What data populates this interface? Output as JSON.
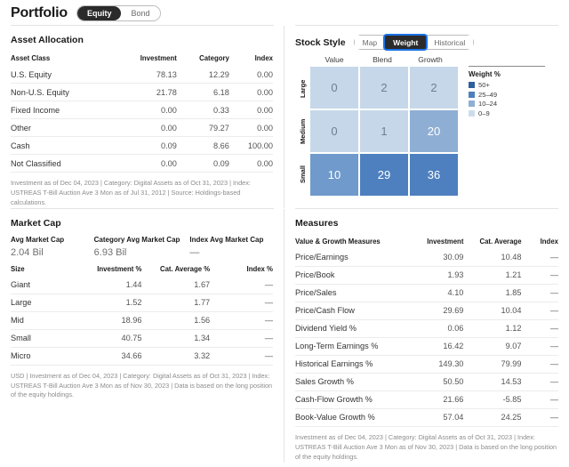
{
  "header": {
    "title": "Portfolio",
    "toggle": {
      "options": [
        "Equity",
        "Bond"
      ],
      "selected": "Equity"
    }
  },
  "asset_allocation": {
    "title": "Asset Allocation",
    "columns": [
      "Asset Class",
      "Investment",
      "Category",
      "Index"
    ],
    "rows": [
      {
        "label": "U.S. Equity",
        "investment": "78.13",
        "category": "12.29",
        "index": "0.00"
      },
      {
        "label": "Non-U.S. Equity",
        "investment": "21.78",
        "category": "6.18",
        "index": "0.00"
      },
      {
        "label": "Fixed Income",
        "investment": "0.00",
        "category": "0.33",
        "index": "0.00"
      },
      {
        "label": "Other",
        "investment": "0.00",
        "category": "79.27",
        "index": "0.00"
      },
      {
        "label": "Cash",
        "investment": "0.09",
        "category": "8.66",
        "index": "100.00"
      },
      {
        "label": "Not Classified",
        "investment": "0.00",
        "category": "0.09",
        "index": "0.00"
      }
    ],
    "footnote": "Investment as of Dec 04, 2023 | Category: Digital Assets as of Oct 31, 2023 | Index: USTREAS T-Bill Auction Ave 3 Mon as of Jul 31, 2012 | Source: Holdings-based calculations."
  },
  "stock_style": {
    "title": "Stock Style",
    "toggle": {
      "options": [
        "Map",
        "Weight",
        "Historical"
      ],
      "selected": "Weight"
    },
    "col_labels": [
      "Value",
      "Blend",
      "Growth"
    ],
    "row_labels": [
      "Large",
      "Medium",
      "Small"
    ],
    "cells": [
      [
        {
          "value": "0",
          "color": "#c6d7e9",
          "text_color": "#6f7f91"
        },
        {
          "value": "2",
          "color": "#c6d7e9",
          "text_color": "#6f7f91"
        },
        {
          "value": "2",
          "color": "#c6d7e9",
          "text_color": "#6f7f91"
        }
      ],
      [
        {
          "value": "0",
          "color": "#c6d7e9",
          "text_color": "#6f7f91"
        },
        {
          "value": "1",
          "color": "#c6d7e9",
          "text_color": "#6f7f91"
        },
        {
          "value": "20",
          "color": "#8eaed4",
          "text_color": "#ffffff"
        }
      ],
      [
        {
          "value": "10",
          "color": "#6f9acb",
          "text_color": "#ffffff"
        },
        {
          "value": "29",
          "color": "#4e80bf",
          "text_color": "#ffffff"
        },
        {
          "value": "36",
          "color": "#4e80bf",
          "text_color": "#ffffff"
        }
      ]
    ],
    "legend": {
      "title": "Weight %",
      "items": [
        {
          "label": "50+",
          "color": "#2f5f9e"
        },
        {
          "label": "25–49",
          "color": "#4e80bf"
        },
        {
          "label": "10–24",
          "color": "#8eaed4"
        },
        {
          "label": "0–9",
          "color": "#ccdcec"
        }
      ]
    }
  },
  "market_cap": {
    "title": "Market Cap",
    "summary": [
      {
        "label": "Avg Market Cap",
        "value": "2.04 Bil"
      },
      {
        "label": "Category Avg Market Cap",
        "value": "6.93 Bil"
      },
      {
        "label": "Index Avg Market Cap",
        "value": "—"
      }
    ],
    "columns": [
      "Size",
      "Investment %",
      "Cat. Average %",
      "Index %"
    ],
    "rows": [
      {
        "label": "Giant",
        "investment": "1.44",
        "cat_average": "1.67",
        "index": "—"
      },
      {
        "label": "Large",
        "investment": "1.52",
        "cat_average": "1.77",
        "index": "—"
      },
      {
        "label": "Mid",
        "investment": "18.96",
        "cat_average": "1.56",
        "index": "—"
      },
      {
        "label": "Small",
        "investment": "40.75",
        "cat_average": "1.34",
        "index": "—"
      },
      {
        "label": "Micro",
        "investment": "34.66",
        "cat_average": "3.32",
        "index": "—"
      }
    ],
    "footnote": "USD | Investment as of Dec 04, 2023 | Category: Digital Assets as of Oct 31, 2023 | Index: USTREAS T-Bill Auction Ave 3 Mon as of Nov 30, 2023 | Data is based on the long position of the equity holdings."
  },
  "measures": {
    "title": "Measures",
    "columns": [
      "Value & Growth Measures",
      "Investment",
      "Cat. Average",
      "Index"
    ],
    "rows": [
      {
        "label": "Price/Earnings",
        "investment": "30.09",
        "cat_average": "10.48",
        "index": "—"
      },
      {
        "label": "Price/Book",
        "investment": "1.93",
        "cat_average": "1.21",
        "index": "—"
      },
      {
        "label": "Price/Sales",
        "investment": "4.10",
        "cat_average": "1.85",
        "index": "—"
      },
      {
        "label": "Price/Cash Flow",
        "investment": "29.69",
        "cat_average": "10.04",
        "index": "—"
      },
      {
        "label": "Dividend Yield %",
        "investment": "0.06",
        "cat_average": "1.12",
        "index": "—"
      },
      {
        "label": "Long-Term Earnings %",
        "investment": "16.42",
        "cat_average": "9.07",
        "index": "—"
      },
      {
        "label": "Historical Earnings %",
        "investment": "149.30",
        "cat_average": "79.99",
        "index": "—"
      },
      {
        "label": "Sales Growth %",
        "investment": "50.50",
        "cat_average": "14.53",
        "index": "—"
      },
      {
        "label": "Cash-Flow Growth %",
        "investment": "21.66",
        "cat_average": "-5.85",
        "index": "—"
      },
      {
        "label": "Book-Value Growth %",
        "investment": "57.04",
        "cat_average": "24.25",
        "index": "—"
      }
    ],
    "footnote": "Investment as of Dec 04, 2023 | Category: Digital Assets as of Oct 31, 2023 | Index: USTREAS T-Bill Auction Ave 3 Mon as of Nov 30, 2023 | Data is based on the long position of the equity holdings."
  }
}
